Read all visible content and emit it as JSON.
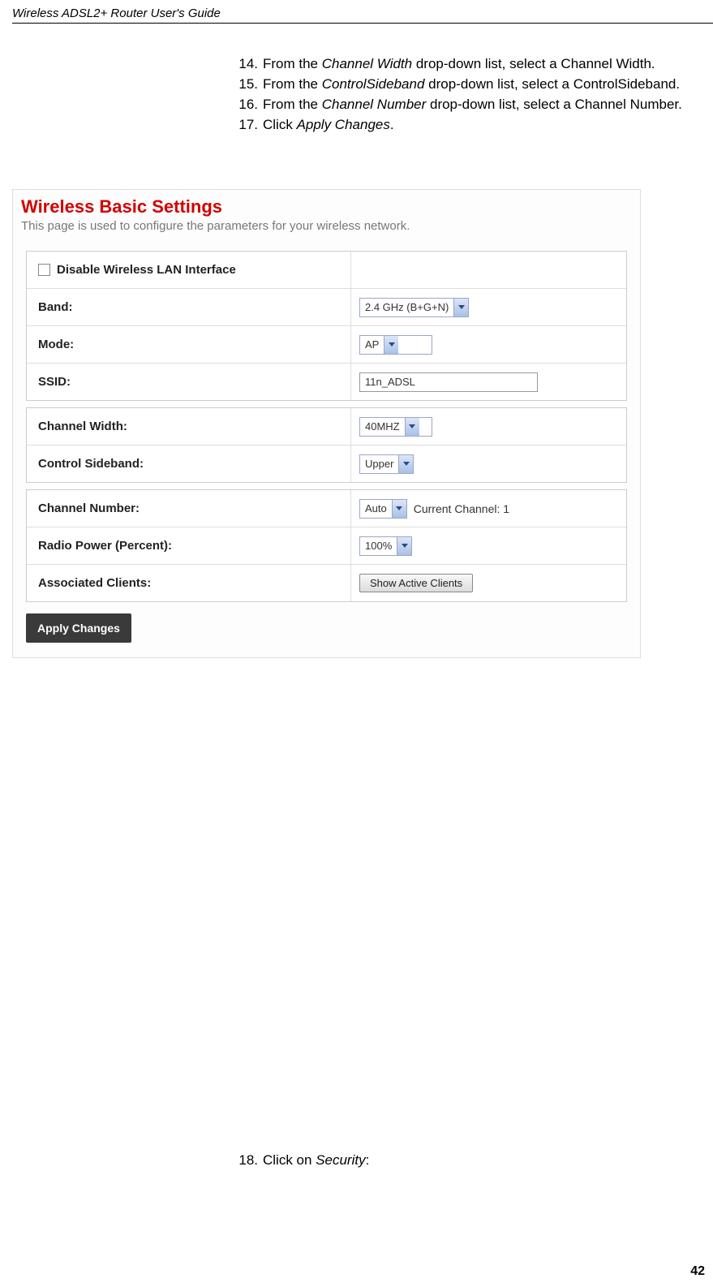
{
  "header": "Wireless ADSL2+ Router User's Guide",
  "steps": {
    "s14": {
      "num": "14.",
      "pre": "From the ",
      "em": "Channel Width",
      "post": " drop-down list, select a Channel Width."
    },
    "s15": {
      "num": "15.",
      "pre": "From the ",
      "em": "ControlSideband",
      "post": " drop-down list, select a ControlSideband."
    },
    "s16": {
      "num": "16.",
      "pre": "From the ",
      "em": "Channel Number",
      "post": " drop-down list, select a Channel Number."
    },
    "s17": {
      "num": "17.",
      "pre": "Click ",
      "em": "Apply Changes",
      "post": "."
    },
    "s18": {
      "num": "18.",
      "pre": "Click on ",
      "em": "Security",
      "post": ":"
    }
  },
  "screenshot": {
    "title": "Wireless Basic Settings",
    "subtitle": "This page is used to configure the parameters for your wireless network.",
    "disable_label": "Disable Wireless LAN Interface",
    "band_label": "Band:",
    "band_value": "2.4 GHz (B+G+N)",
    "mode_label": "Mode:",
    "mode_value": "AP",
    "ssid_label": "SSID:",
    "ssid_value": "11n_ADSL",
    "cw_label": "Channel Width:",
    "cw_value": "40MHZ",
    "cs_label": "Control Sideband:",
    "cs_value": "Upper",
    "cn_label": "Channel Number:",
    "cn_value": "Auto",
    "cn_current": "Current Channel: 1",
    "rp_label": "Radio Power (Percent):",
    "rp_value": "100%",
    "ac_label": "Associated Clients:",
    "ac_button": "Show Active Clients",
    "apply": "Apply Changes"
  },
  "page_number": "42"
}
